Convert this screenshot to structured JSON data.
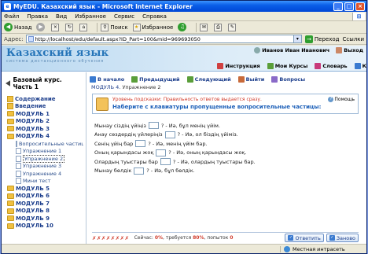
{
  "window": {
    "title": "MyEDU. Казахский язык - Microsoft Internet Explorer"
  },
  "menu": [
    "Файл",
    "Правка",
    "Вид",
    "Избранное",
    "Сервис",
    "Справка"
  ],
  "toolbar": {
    "back": "Назад",
    "search": "Поиск",
    "favorites": "Избранное"
  },
  "address": {
    "label": "Адрес:",
    "url": "http://localhost/edu/default.aspx?ID_Part=100&mid=969693050",
    "go": "Переход",
    "links": "Ссылки"
  },
  "header": {
    "logo": "Казахский язык",
    "logo_sub": "система дистанционного обучения",
    "user": "Иванов Иван Иванович",
    "exit": "Выход",
    "nav": [
      "Инструкция",
      "Мои Курсы",
      "Словарь",
      "К"
    ]
  },
  "sidebar": {
    "course": "Базовый курс. Часть 1",
    "top_items": [
      "Содержание",
      "Введение"
    ],
    "modules_before": [
      "МОДУЛЬ 1",
      "МОДУЛЬ 2",
      "МОДУЛЬ 3"
    ],
    "open_module": "МОДУЛЬ 4",
    "sub_items": [
      {
        "label": "Вопросительные частицы",
        "selected": false
      },
      {
        "label": "Упражнение 1",
        "selected": false
      },
      {
        "label": "Упражнение 2",
        "selected": true
      },
      {
        "label": "Упражнение 3",
        "selected": false
      },
      {
        "label": "Упражнение 4",
        "selected": false
      },
      {
        "label": "Мини тест",
        "selected": false
      }
    ],
    "modules_after": [
      "МОДУЛЬ 5",
      "МОДУЛЬ 6",
      "МОДУЛЬ 7",
      "МОДУЛЬ 8",
      "МОДУЛЬ 9",
      "МОДУЛЬ 10"
    ]
  },
  "content": {
    "nav": [
      "В начало",
      "Предыдущий",
      "Следующий",
      "Выйти",
      "Вопросы"
    ],
    "breadcrumb_module": "МОДУЛЬ 4.",
    "breadcrumb_page": "Упражнение 2",
    "hint": "Уровень подсказки: Правильность ответов выдается сразу.",
    "instruction": "Наберите с клавиатуры пропущенные вопросительные частицы:",
    "help": "Помощь",
    "lines": [
      {
        "before": "Мынау сіздің үйіңіз",
        "after": "? - Иә, бұл менің үйім."
      },
      {
        "before": "Анау сөздердің үйлеріңіз",
        "after": "? - Иә, ол біздің үйіміз."
      },
      {
        "before": "Сенің үйің бар",
        "after": "? - Иә, менің үйім бар."
      },
      {
        "before": "Оның қарындасы жоқ",
        "after": "? - Иә, оның қарындасы жоқ."
      },
      {
        "before": "Олардың туыстары бар",
        "after": "? - Иә, олардың туыстары бар."
      },
      {
        "before": "Мынау бөлдік",
        "after": "? - Иә, бұл бөлдік."
      }
    ],
    "marks": "✗✗✗✗✗✗✗✗",
    "status_now_label": "Сейчас:",
    "status_now": "0%",
    "status_need_label": "требуется",
    "status_need": "80%",
    "status_tries_label": "попыток",
    "status_tries": "0",
    "answer_button": "Ответить",
    "again_button": "Заново"
  },
  "statusbar": {
    "zone": "Местная интрасеть"
  }
}
